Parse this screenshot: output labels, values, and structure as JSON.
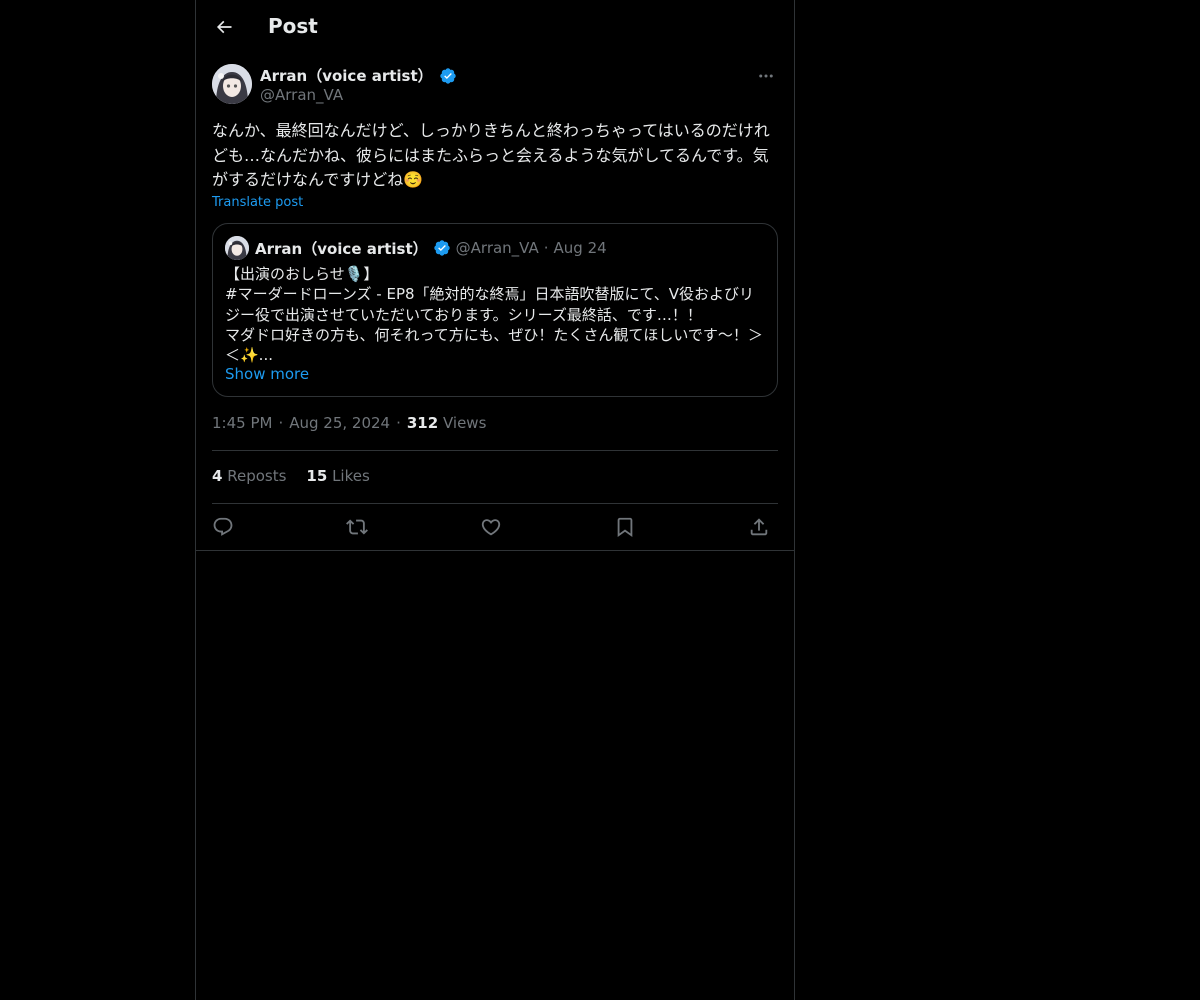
{
  "header": {
    "title": "Post",
    "back_icon": "arrow-left-icon"
  },
  "post": {
    "author_name": "Arran（voice artist）",
    "handle": "@Arran_VA",
    "verified_color": "#1d9bf0",
    "text": "なんか、最終回なんだけど、しっかりきちんと終わっちゃってはいるのだけれども…なんだかね、彼らにはまたふらっと会えるような気がしてるんです。気がするだけなんですけどね☺️",
    "translate_label": "Translate post",
    "time": "1:45 PM",
    "date": "Aug 25, 2024",
    "views_count": "312",
    "views_label": "Views",
    "separator": "·",
    "reposts_count": "4",
    "reposts_label": "Reposts",
    "likes_count": "15",
    "likes_label": "Likes"
  },
  "quote": {
    "author_name": "Arran（voice artist）",
    "handle": "@Arran_VA",
    "separator": "·",
    "date": "Aug 24",
    "text": "【出演のおしらせ🎙️】\n#マーダードローンズ - EP8「絶対的な終焉」日本語吹替版にて、V役およびリジー役で出演させていただいております。シリーズ最終話、です…！！\nマダドロ好きの方も、何それって方にも、ぜひ！たくさん観てほしいです〜！＞＜✨...",
    "show_more_label": "Show more"
  },
  "actions": [
    "reply-icon",
    "repost-icon",
    "like-icon",
    "bookmark-icon",
    "share-icon"
  ],
  "colors": {
    "background": "#000000",
    "text": "#e7e9ea",
    "muted": "#71767b",
    "accent": "#1d9bf0",
    "border": "#2f3336"
  }
}
